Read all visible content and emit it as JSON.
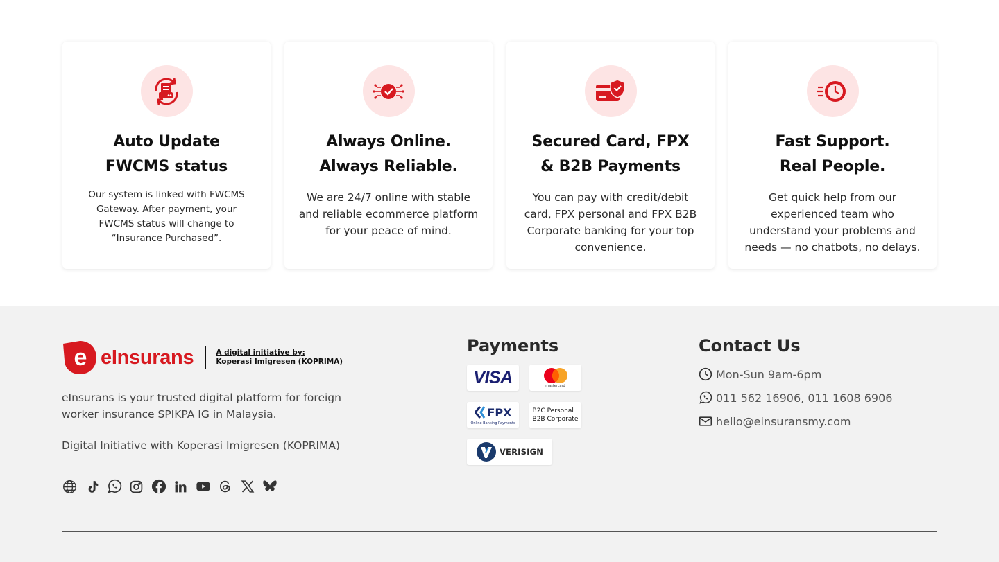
{
  "features": [
    {
      "title_line1": "Auto Update",
      "title_line2": "FWCMS status",
      "text": "Our system is linked with FWCMS Gateway. After payment, your FWCMS status will change to “Insurance Purchased”.",
      "icon": "document-refresh-icon"
    },
    {
      "title_line1": "Always Online.",
      "title_line2": "Always Reliable.",
      "text": "We are 24/7 online with stable and reliable ecommerce platform for your peace of mind.",
      "icon": "network-check-icon"
    },
    {
      "title_line1": "Secured Card, FPX",
      "title_line2": "& B2B Payments",
      "text": "You can pay with credit/debit card, FPX personal and FPX B2B Corporate banking for your top convenience.",
      "icon": "secure-card-icon"
    },
    {
      "title_line1": "Fast Support.",
      "title_line2": "Real People.",
      "text": "Get quick help from our experienced team who understand your problems and needs — no chatbots, no delays.",
      "icon": "fast-clock-icon"
    }
  ],
  "footer": {
    "brand": "eInsurans",
    "tagline_line1": "A digital initiative by:",
    "tagline_line2": "Koperasi Imigresen (KOPRIMA)",
    "about": "eInsurans is your trusted digital platform for foreign worker insurance SPIKPA IG in Malaysia.",
    "initiative": "Digital Initiative with Koperasi Imigresen (KOPRIMA)",
    "socials": [
      "globe-icon",
      "tiktok-icon",
      "whatsapp-icon",
      "instagram-icon",
      "facebook-icon",
      "linkedin-icon",
      "youtube-icon",
      "threads-icon",
      "x-icon",
      "bluesky-icon"
    ]
  },
  "payments": {
    "title": "Payments",
    "visa": "VISA",
    "mastercard": "mastercard",
    "fpx": "FPX",
    "fpx_sub": "Online Banking Payments",
    "b2c_line1": "B2C Personal",
    "b2c_line2": "B2B Corporate",
    "verisign": "VERISIGN"
  },
  "contact": {
    "title": "Contact Us",
    "hours": "Mon-Sun 9am-6pm",
    "phone": "011 562 16906, 011 1608 6906",
    "email": "hello@einsuransmy.com"
  },
  "colors": {
    "brand_red": "#d71920",
    "icon_bg": "#fde4e4",
    "footer_bg": "#f2f2f2"
  }
}
